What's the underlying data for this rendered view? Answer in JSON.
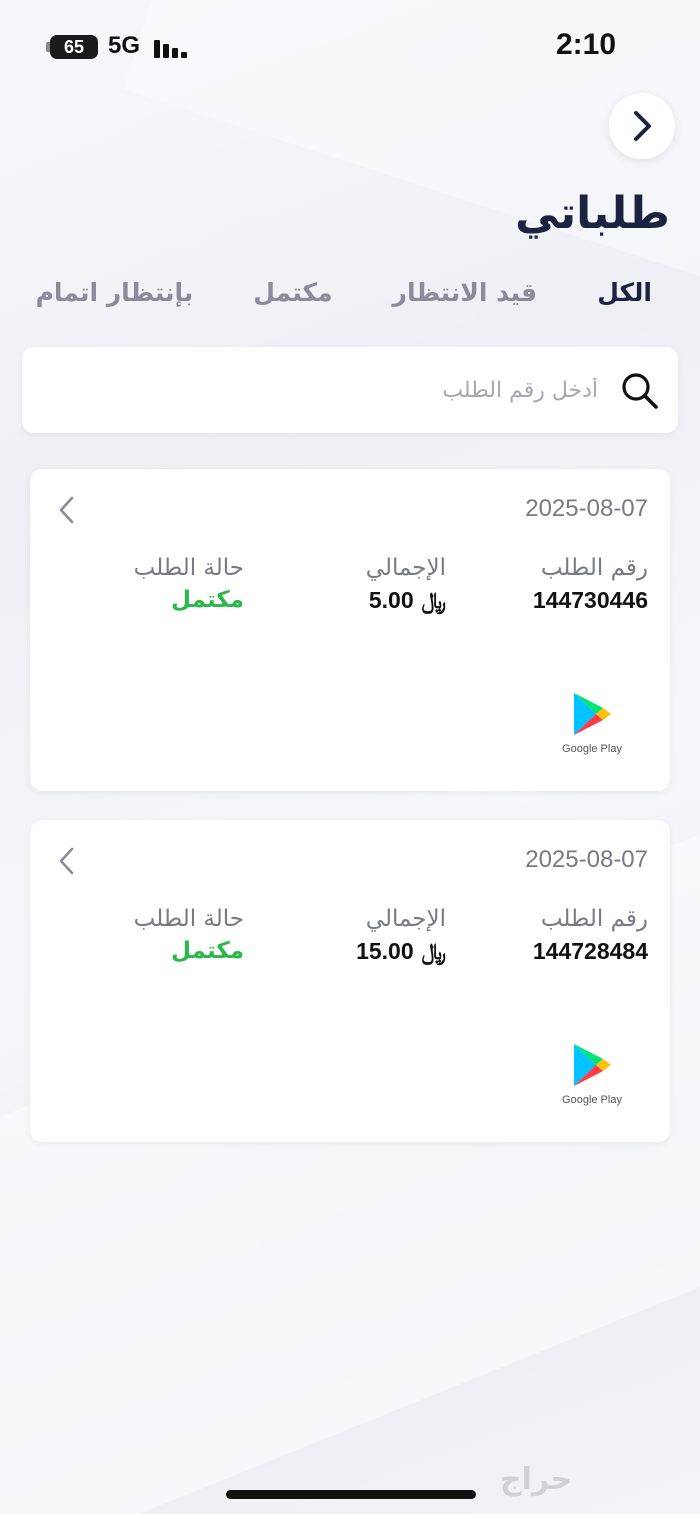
{
  "status_bar": {
    "battery": "65",
    "network": "5G",
    "time": "2:10"
  },
  "header": {
    "title": "طلباتي",
    "back_icon": "chevron-right-icon"
  },
  "tabs": [
    {
      "label": "الكل",
      "active": true
    },
    {
      "label": "قيد الانتظار",
      "active": false
    },
    {
      "label": "مكتمل",
      "active": false
    },
    {
      "label": "بإنتظار اتمام",
      "active": false
    }
  ],
  "search": {
    "placeholder": "أدخل رقم الطلب",
    "value": ""
  },
  "orders": [
    {
      "date": "2025-08-07",
      "order_number_label": "رقم الطلب",
      "order_number": "144730446",
      "total_label": "الإجمالي",
      "total": "5.00",
      "status_label": "حالة الطلب",
      "status": "مكتمل",
      "status_color": "#2bb84a",
      "provider": "Google Play"
    },
    {
      "date": "2025-08-07",
      "order_number_label": "رقم الطلب",
      "order_number": "144728484",
      "total_label": "الإجمالي",
      "total": "15.00",
      "status_label": "حالة الطلب",
      "status": "مكتمل",
      "status_color": "#2bb84a",
      "provider": "Google Play"
    }
  ],
  "watermark": "حراج",
  "currency_symbol": "﷼"
}
